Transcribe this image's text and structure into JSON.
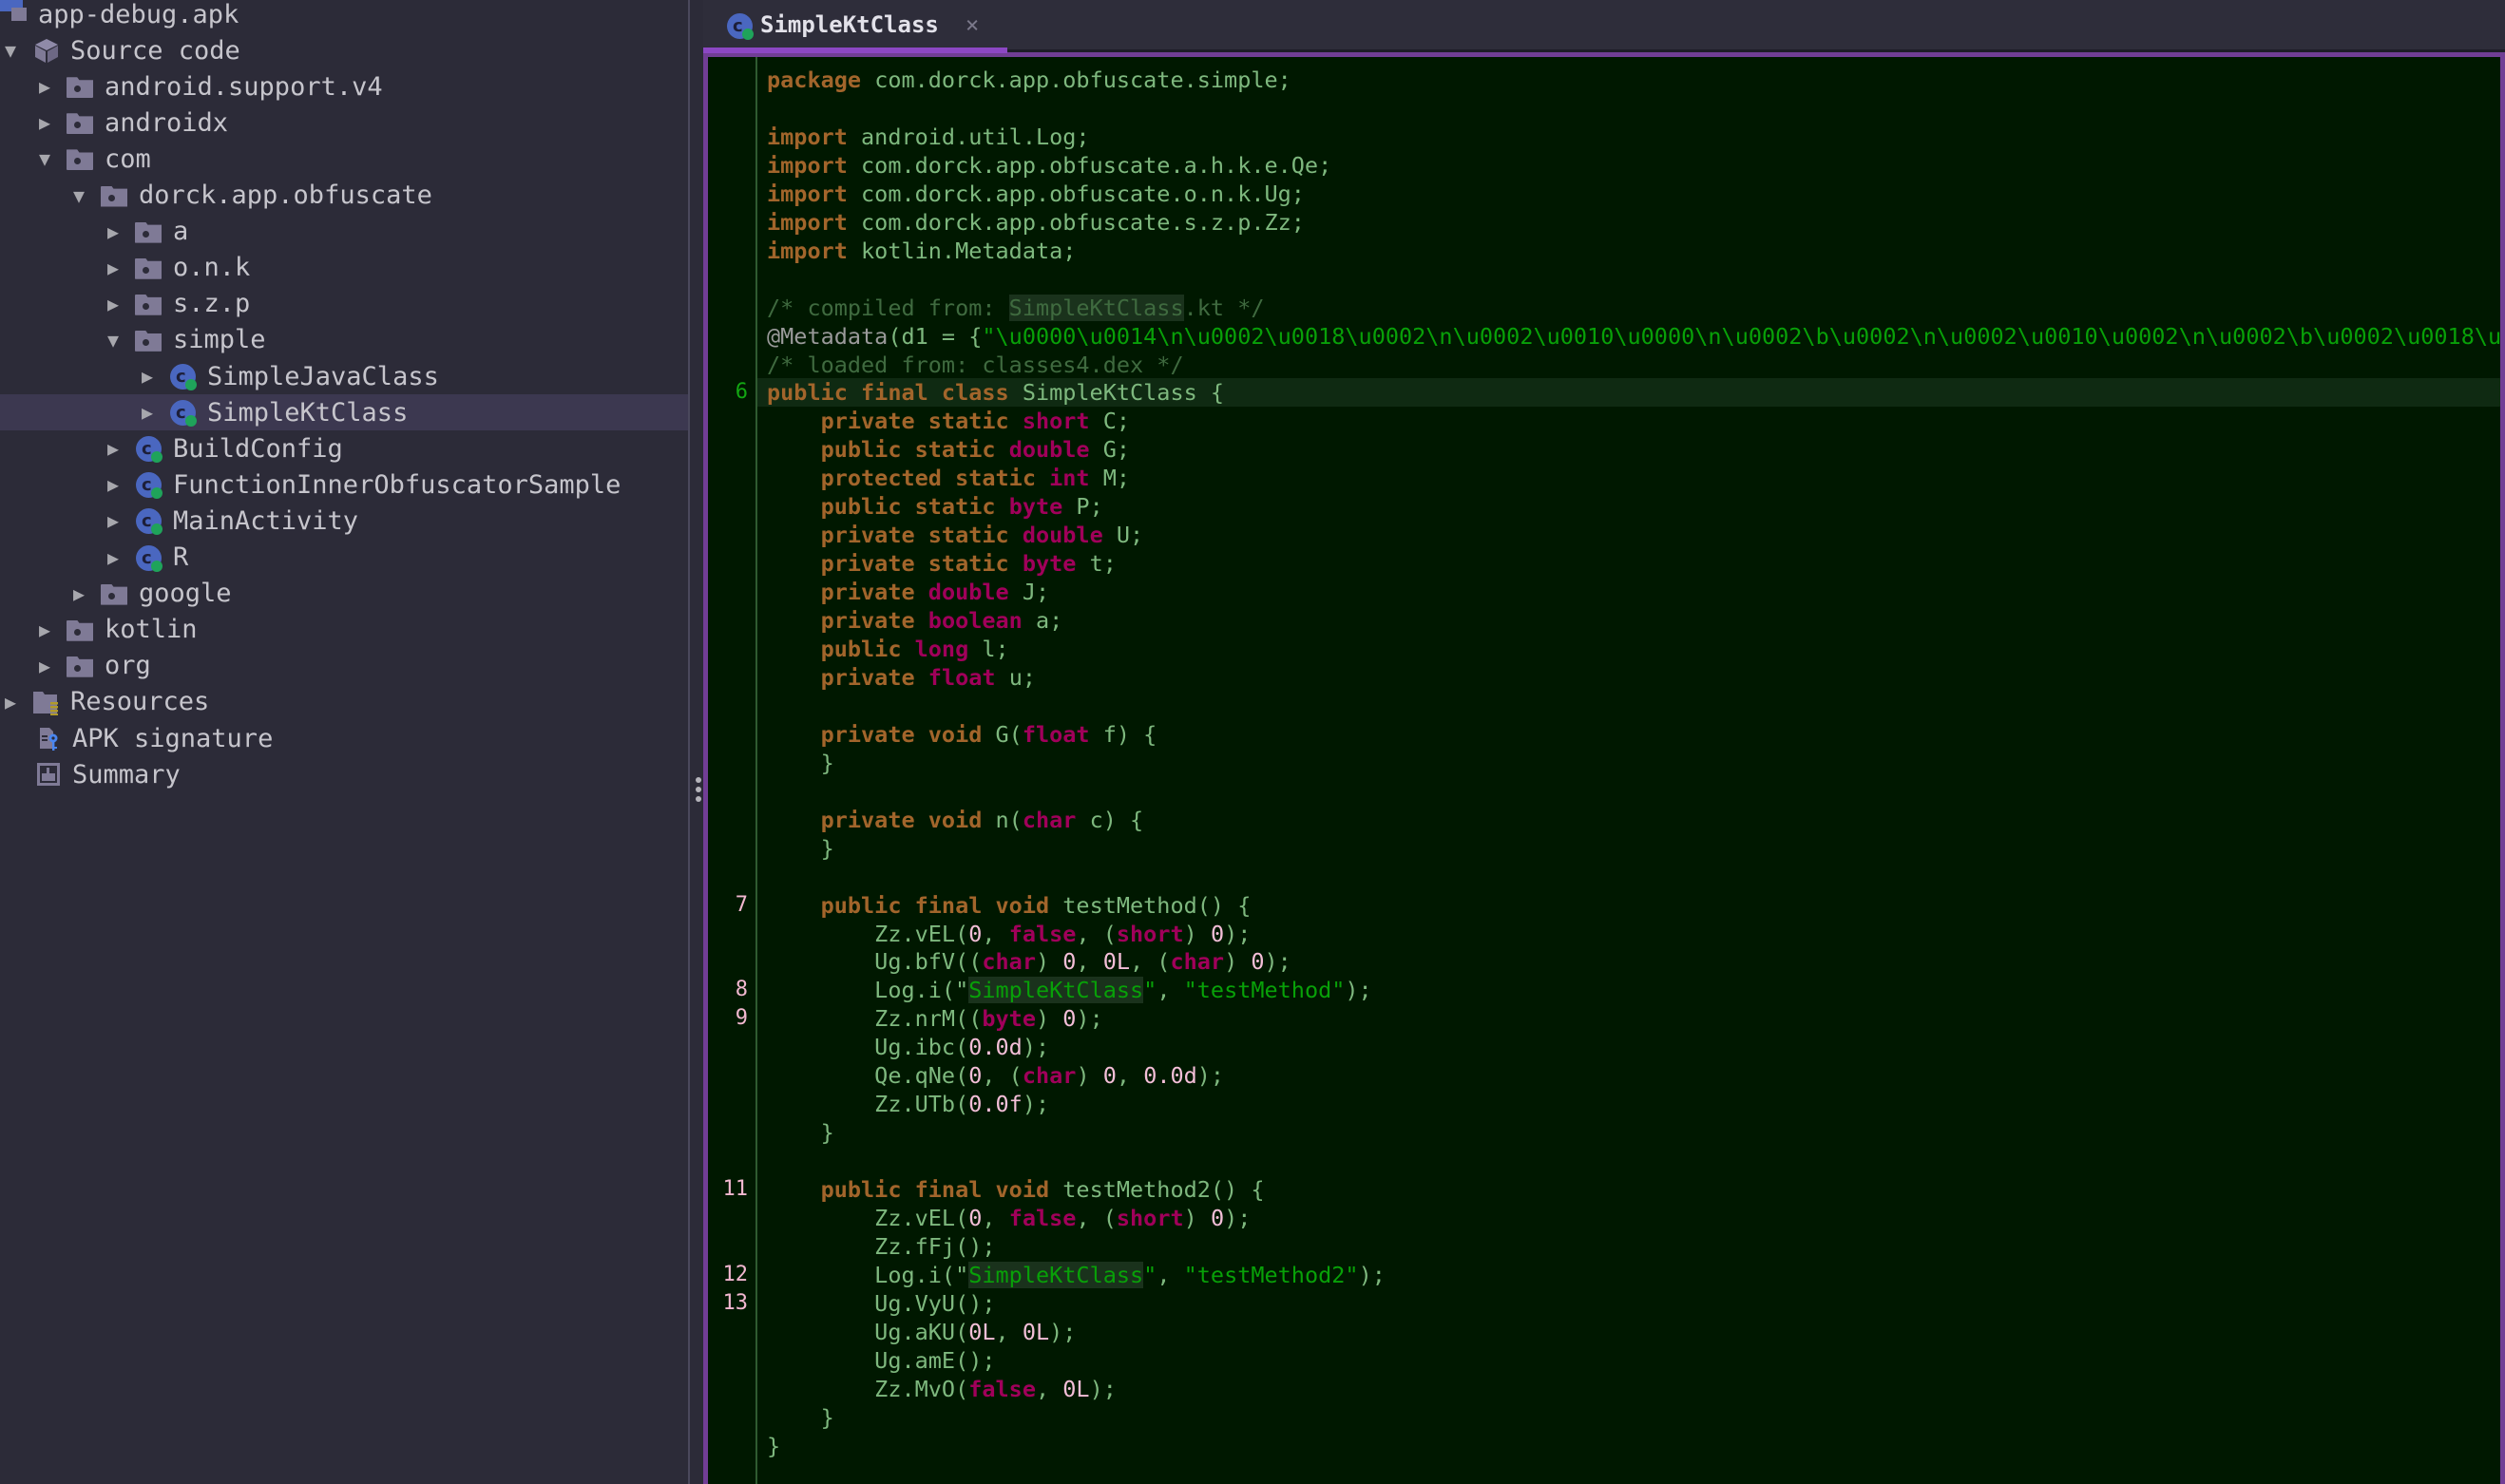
{
  "sidebar": {
    "items": [
      {
        "label": "app-debug.apk",
        "icon": "apk-icon",
        "depth": 0,
        "arrow": "none"
      },
      {
        "label": "Source code",
        "icon": "cube-icon",
        "depth": 0,
        "arrow": "expanded"
      },
      {
        "label": "android.support.v4",
        "icon": "package-folder-icon",
        "depth": 1,
        "arrow": "collapsed"
      },
      {
        "label": "androidx",
        "icon": "package-folder-icon",
        "depth": 1,
        "arrow": "collapsed"
      },
      {
        "label": "com",
        "icon": "package-folder-icon",
        "depth": 1,
        "arrow": "expanded"
      },
      {
        "label": "dorck.app.obfuscate",
        "icon": "package-folder-icon",
        "depth": 2,
        "arrow": "expanded"
      },
      {
        "label": "a",
        "icon": "package-folder-icon",
        "depth": 3,
        "arrow": "collapsed"
      },
      {
        "label": "o.n.k",
        "icon": "package-folder-icon",
        "depth": 3,
        "arrow": "collapsed"
      },
      {
        "label": "s.z.p",
        "icon": "package-folder-icon",
        "depth": 3,
        "arrow": "collapsed"
      },
      {
        "label": "simple",
        "icon": "package-folder-icon",
        "depth": 3,
        "arrow": "expanded"
      },
      {
        "label": "SimpleJavaClass",
        "icon": "class-icon",
        "depth": 4,
        "arrow": "collapsed"
      },
      {
        "label": "SimpleKtClass",
        "icon": "class-icon",
        "depth": 4,
        "arrow": "collapsed",
        "selected": true
      },
      {
        "label": "BuildConfig",
        "icon": "class-icon",
        "depth": 3,
        "arrow": "collapsed"
      },
      {
        "label": "FunctionInnerObfuscatorSample",
        "icon": "class-icon",
        "depth": 3,
        "arrow": "collapsed"
      },
      {
        "label": "MainActivity",
        "icon": "class-icon",
        "depth": 3,
        "arrow": "collapsed"
      },
      {
        "label": "R",
        "icon": "class-icon",
        "depth": 3,
        "arrow": "collapsed"
      },
      {
        "label": "google",
        "icon": "package-folder-icon",
        "depth": 2,
        "arrow": "collapsed"
      },
      {
        "label": "kotlin",
        "icon": "package-folder-icon",
        "depth": 1,
        "arrow": "collapsed"
      },
      {
        "label": "org",
        "icon": "package-folder-icon",
        "depth": 1,
        "arrow": "collapsed"
      },
      {
        "label": "Resources",
        "icon": "resources-icon",
        "depth": 0,
        "arrow": "collapsed"
      },
      {
        "label": "APK signature",
        "icon": "apk-signature-icon",
        "depth": 0,
        "arrow": "none"
      },
      {
        "label": "Summary",
        "icon": "summary-icon",
        "depth": 0,
        "arrow": "none"
      }
    ]
  },
  "editor": {
    "tab": {
      "title": "SimpleKtClass",
      "close_glyph": "×"
    },
    "colors": {
      "accent": "#8c47c4",
      "background": "#001800"
    },
    "lines": [
      {
        "ln": "",
        "t": [
          [
            "kw",
            "package"
          ],
          [
            "pl",
            " com.dorck.app.obfuscate.simple;"
          ]
        ]
      },
      {
        "ln": "",
        "t": []
      },
      {
        "ln": "",
        "t": [
          [
            "kw",
            "import"
          ],
          [
            "pl",
            " android.util.Log;"
          ]
        ]
      },
      {
        "ln": "",
        "t": [
          [
            "kw",
            "import"
          ],
          [
            "pl",
            " com.dorck.app.obfuscate.a.h.k.e.Qe;"
          ]
        ]
      },
      {
        "ln": "",
        "t": [
          [
            "kw",
            "import"
          ],
          [
            "pl",
            " com.dorck.app.obfuscate.o.n.k.Ug;"
          ]
        ]
      },
      {
        "ln": "",
        "t": [
          [
            "kw",
            "import"
          ],
          [
            "pl",
            " com.dorck.app.obfuscate.s.z.p.Zz;"
          ]
        ]
      },
      {
        "ln": "",
        "t": [
          [
            "kw",
            "import"
          ],
          [
            "pl",
            " kotlin.Metadata;"
          ]
        ]
      },
      {
        "ln": "",
        "t": []
      },
      {
        "ln": "",
        "t": [
          [
            "cm",
            "/* compiled from: "
          ],
          [
            "cm hl",
            "SimpleKtClass"
          ],
          [
            "cm",
            ".kt */"
          ]
        ]
      },
      {
        "ln": "",
        "t": [
          [
            "ann",
            "@Metadata"
          ],
          [
            "pl",
            "(d1 = {"
          ],
          [
            "str",
            "\"\\u0000\\u0014\\n\\u0002\\u0018\\u0002\\n\\u0002\\u0010\\u0000\\n\\u0002\\b\\u0002\\n\\u0002\\u0010\\u0002\\n\\u0002\\b\\u0002\\u0018\\u0"
          ]
        ]
      },
      {
        "ln": "",
        "t": [
          [
            "cm",
            "/* loaded from: classes4.dex */"
          ]
        ]
      },
      {
        "ln": "6",
        "lnc": "green",
        "current": true,
        "t": [
          [
            "kw",
            "public final class"
          ],
          [
            "pl",
            " SimpleKtClass {"
          ]
        ]
      },
      {
        "ln": "",
        "t": [
          [
            "pl",
            "    "
          ],
          [
            "kw",
            "private static"
          ],
          [
            "pl",
            " "
          ],
          [
            "ty",
            "short"
          ],
          [
            "pl",
            " C;"
          ]
        ]
      },
      {
        "ln": "",
        "t": [
          [
            "pl",
            "    "
          ],
          [
            "kw",
            "public static"
          ],
          [
            "pl",
            " "
          ],
          [
            "ty",
            "double"
          ],
          [
            "pl",
            " G;"
          ]
        ]
      },
      {
        "ln": "",
        "t": [
          [
            "pl",
            "    "
          ],
          [
            "kw",
            "protected static"
          ],
          [
            "pl",
            " "
          ],
          [
            "ty",
            "int"
          ],
          [
            "pl",
            " M;"
          ]
        ]
      },
      {
        "ln": "",
        "t": [
          [
            "pl",
            "    "
          ],
          [
            "kw",
            "public static"
          ],
          [
            "pl",
            " "
          ],
          [
            "ty",
            "byte"
          ],
          [
            "pl",
            " P;"
          ]
        ]
      },
      {
        "ln": "",
        "t": [
          [
            "pl",
            "    "
          ],
          [
            "kw",
            "private static"
          ],
          [
            "pl",
            " "
          ],
          [
            "ty",
            "double"
          ],
          [
            "pl",
            " U;"
          ]
        ]
      },
      {
        "ln": "",
        "t": [
          [
            "pl",
            "    "
          ],
          [
            "kw",
            "private static"
          ],
          [
            "pl",
            " "
          ],
          [
            "ty",
            "byte"
          ],
          [
            "pl",
            " t;"
          ]
        ]
      },
      {
        "ln": "",
        "t": [
          [
            "pl",
            "    "
          ],
          [
            "kw",
            "private"
          ],
          [
            "pl",
            " "
          ],
          [
            "ty",
            "double"
          ],
          [
            "pl",
            " J;"
          ]
        ]
      },
      {
        "ln": "",
        "t": [
          [
            "pl",
            "    "
          ],
          [
            "kw",
            "private"
          ],
          [
            "pl",
            " "
          ],
          [
            "ty",
            "boolean"
          ],
          [
            "pl",
            " a;"
          ]
        ]
      },
      {
        "ln": "",
        "t": [
          [
            "pl",
            "    "
          ],
          [
            "kw",
            "public"
          ],
          [
            "pl",
            " "
          ],
          [
            "ty",
            "long"
          ],
          [
            "pl",
            " l;"
          ]
        ]
      },
      {
        "ln": "",
        "t": [
          [
            "pl",
            "    "
          ],
          [
            "kw",
            "private"
          ],
          [
            "pl",
            " "
          ],
          [
            "ty",
            "float"
          ],
          [
            "pl",
            " u;"
          ]
        ]
      },
      {
        "ln": "",
        "t": []
      },
      {
        "ln": "",
        "t": [
          [
            "pl",
            "    "
          ],
          [
            "kw",
            "private void"
          ],
          [
            "pl",
            " G("
          ],
          [
            "ty",
            "float"
          ],
          [
            "pl",
            " f) {"
          ]
        ]
      },
      {
        "ln": "",
        "t": [
          [
            "pl",
            "    }"
          ]
        ]
      },
      {
        "ln": "",
        "t": []
      },
      {
        "ln": "",
        "t": [
          [
            "pl",
            "    "
          ],
          [
            "kw",
            "private void"
          ],
          [
            "pl",
            " n("
          ],
          [
            "ty",
            "char"
          ],
          [
            "pl",
            " c) {"
          ]
        ]
      },
      {
        "ln": "",
        "t": [
          [
            "pl",
            "    }"
          ]
        ]
      },
      {
        "ln": "",
        "t": []
      },
      {
        "ln": "7",
        "lnc": "pink",
        "t": [
          [
            "pl",
            "    "
          ],
          [
            "kw",
            "public final void"
          ],
          [
            "pl",
            " testMethod() {"
          ]
        ]
      },
      {
        "ln": "",
        "t": [
          [
            "pl",
            "        Zz.vEL("
          ],
          [
            "num",
            "0"
          ],
          [
            "pl",
            ", "
          ],
          [
            "ty",
            "false"
          ],
          [
            "pl",
            ", ("
          ],
          [
            "ty",
            "short"
          ],
          [
            "pl",
            ") "
          ],
          [
            "num",
            "0"
          ],
          [
            "pl",
            ");"
          ]
        ]
      },
      {
        "ln": "",
        "t": [
          [
            "pl",
            "        Ug.bfV(("
          ],
          [
            "ty",
            "char"
          ],
          [
            "pl",
            ") "
          ],
          [
            "num",
            "0"
          ],
          [
            "pl",
            ", "
          ],
          [
            "num",
            "0L"
          ],
          [
            "pl",
            ", ("
          ],
          [
            "ty",
            "char"
          ],
          [
            "pl",
            ") "
          ],
          [
            "num",
            "0"
          ],
          [
            "pl",
            ");"
          ]
        ]
      },
      {
        "ln": "8",
        "lnc": "pink",
        "t": [
          [
            "pl",
            "        Log.i(\""
          ],
          [
            "str hl",
            "SimpleKtClass"
          ],
          [
            "str",
            "\""
          ],
          [
            "pl",
            ", "
          ],
          [
            "str",
            "\"testMethod\""
          ],
          [
            "pl",
            ");"
          ]
        ]
      },
      {
        "ln": "9",
        "lnc": "pink",
        "t": [
          [
            "pl",
            "        Zz.nrM(("
          ],
          [
            "ty",
            "byte"
          ],
          [
            "pl",
            ") "
          ],
          [
            "num",
            "0"
          ],
          [
            "pl",
            ");"
          ]
        ]
      },
      {
        "ln": "",
        "t": [
          [
            "pl",
            "        Ug.ibc("
          ],
          [
            "num",
            "0.0d"
          ],
          [
            "pl",
            ");"
          ]
        ]
      },
      {
        "ln": "",
        "t": [
          [
            "pl",
            "        Qe.qNe("
          ],
          [
            "num",
            "0"
          ],
          [
            "pl",
            ", ("
          ],
          [
            "ty",
            "char"
          ],
          [
            "pl",
            ") "
          ],
          [
            "num",
            "0"
          ],
          [
            "pl",
            ", "
          ],
          [
            "num",
            "0.0d"
          ],
          [
            "pl",
            ");"
          ]
        ]
      },
      {
        "ln": "",
        "t": [
          [
            "pl",
            "        Zz.UTb("
          ],
          [
            "num",
            "0.0f"
          ],
          [
            "pl",
            ");"
          ]
        ]
      },
      {
        "ln": "",
        "t": [
          [
            "pl",
            "    }"
          ]
        ]
      },
      {
        "ln": "",
        "t": []
      },
      {
        "ln": "11",
        "lnc": "pink",
        "t": [
          [
            "pl",
            "    "
          ],
          [
            "kw",
            "public final void"
          ],
          [
            "pl",
            " testMethod2() {"
          ]
        ]
      },
      {
        "ln": "",
        "t": [
          [
            "pl",
            "        Zz.vEL("
          ],
          [
            "num",
            "0"
          ],
          [
            "pl",
            ", "
          ],
          [
            "ty",
            "false"
          ],
          [
            "pl",
            ", ("
          ],
          [
            "ty",
            "short"
          ],
          [
            "pl",
            ") "
          ],
          [
            "num",
            "0"
          ],
          [
            "pl",
            ");"
          ]
        ]
      },
      {
        "ln": "",
        "t": [
          [
            "pl",
            "        Zz.fFj();"
          ]
        ]
      },
      {
        "ln": "12",
        "lnc": "pink",
        "t": [
          [
            "pl",
            "        Log.i(\""
          ],
          [
            "str hl",
            "SimpleKtClass"
          ],
          [
            "str",
            "\""
          ],
          [
            "pl",
            ", "
          ],
          [
            "str",
            "\"testMethod2\""
          ],
          [
            "pl",
            ");"
          ]
        ]
      },
      {
        "ln": "13",
        "lnc": "pink",
        "t": [
          [
            "pl",
            "        Ug.VyU();"
          ]
        ]
      },
      {
        "ln": "",
        "t": [
          [
            "pl",
            "        Ug.aKU("
          ],
          [
            "num",
            "0L"
          ],
          [
            "pl",
            ", "
          ],
          [
            "num",
            "0L"
          ],
          [
            "pl",
            ");"
          ]
        ]
      },
      {
        "ln": "",
        "t": [
          [
            "pl",
            "        Ug.amE();"
          ]
        ]
      },
      {
        "ln": "",
        "t": [
          [
            "pl",
            "        Zz.MvO("
          ],
          [
            "ty",
            "false"
          ],
          [
            "pl",
            ", "
          ],
          [
            "num",
            "0L"
          ],
          [
            "pl",
            ");"
          ]
        ]
      },
      {
        "ln": "",
        "t": [
          [
            "pl",
            "    }"
          ]
        ]
      },
      {
        "ln": "",
        "t": [
          [
            "pl",
            "}"
          ]
        ]
      }
    ]
  }
}
